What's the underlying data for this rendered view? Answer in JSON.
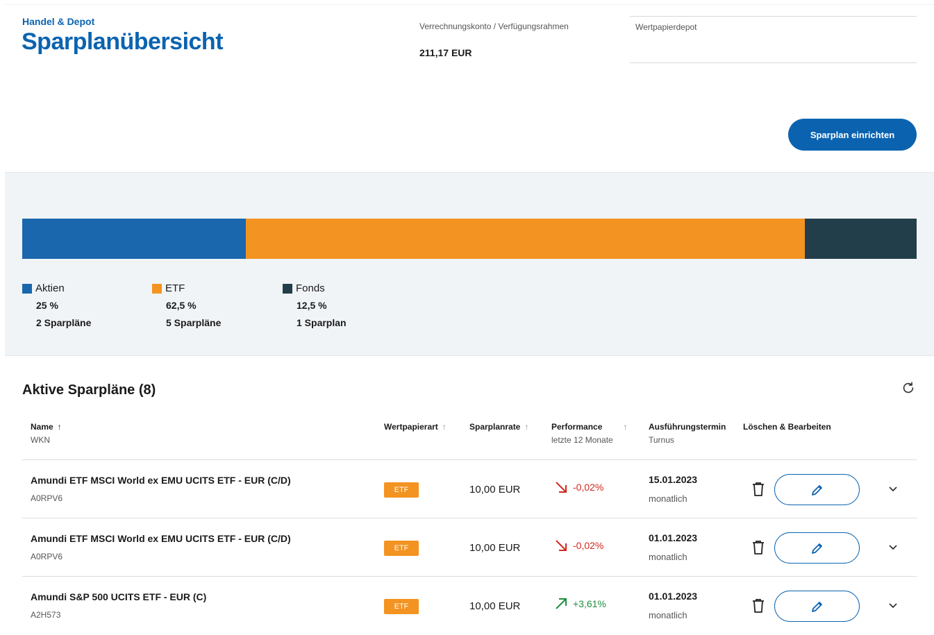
{
  "header": {
    "eyebrow": "Handel & Depot",
    "title": "Sparplanübersicht",
    "account_label": "Verrechnungskonto / Verfügungsrahmen",
    "account_value": "211,17 EUR",
    "depot_label": "Wertpapierdepot",
    "cta_label": "Sparplan einrichten"
  },
  "colors": {
    "brand_blue": "#0b63b0",
    "aktien": "#1a67ad",
    "etf": "#f39321",
    "fonds": "#233e4b",
    "negative": "#d0271d",
    "positive": "#1e8e3e"
  },
  "distribution": {
    "segments": [
      {
        "label": "Aktien",
        "percent_value": 25,
        "percent": "25 %",
        "count": "2 Sparpläne",
        "color": "#1a67ad"
      },
      {
        "label": "ETF",
        "percent_value": 62.5,
        "percent": "62,5 %",
        "count": "5 Sparpläne",
        "color": "#f39321"
      },
      {
        "label": "Fonds",
        "percent_value": 12.5,
        "percent": "12,5 %",
        "count": "1 Sparplan",
        "color": "#233e4b"
      }
    ]
  },
  "list": {
    "title": "Aktive Sparpläne (8)",
    "columns": {
      "name": "Name",
      "name_sub": "WKN",
      "type": "Wertpapierart",
      "rate": "Sparplanrate",
      "performance": "Performance",
      "performance_sub": "letzte 12 Monate",
      "date": "Ausführungstermin",
      "date_sub": "Turnus",
      "actions": "Löschen & Bearbeiten"
    },
    "rows": [
      {
        "name": "Amundi ETF MSCI World ex EMU UCITS ETF - EUR (C/D)",
        "wkn": "A0RPV6",
        "type": "ETF",
        "rate": "10,00 EUR",
        "performance": "-0,02%",
        "trend": "down",
        "date": "15.01.2023",
        "turnus": "monatlich"
      },
      {
        "name": "Amundi ETF MSCI World ex EMU UCITS ETF - EUR (C/D)",
        "wkn": "A0RPV6",
        "type": "ETF",
        "rate": "10,00 EUR",
        "performance": "-0,02%",
        "trend": "down",
        "date": "01.01.2023",
        "turnus": "monatlich"
      },
      {
        "name": "Amundi S&P 500 UCITS ETF - EUR (C)",
        "wkn": "A2H573",
        "type": "ETF",
        "rate": "10,00 EUR",
        "performance": "+3,61%",
        "trend": "up",
        "date": "01.01.2023",
        "turnus": "monatlich"
      }
    ]
  }
}
